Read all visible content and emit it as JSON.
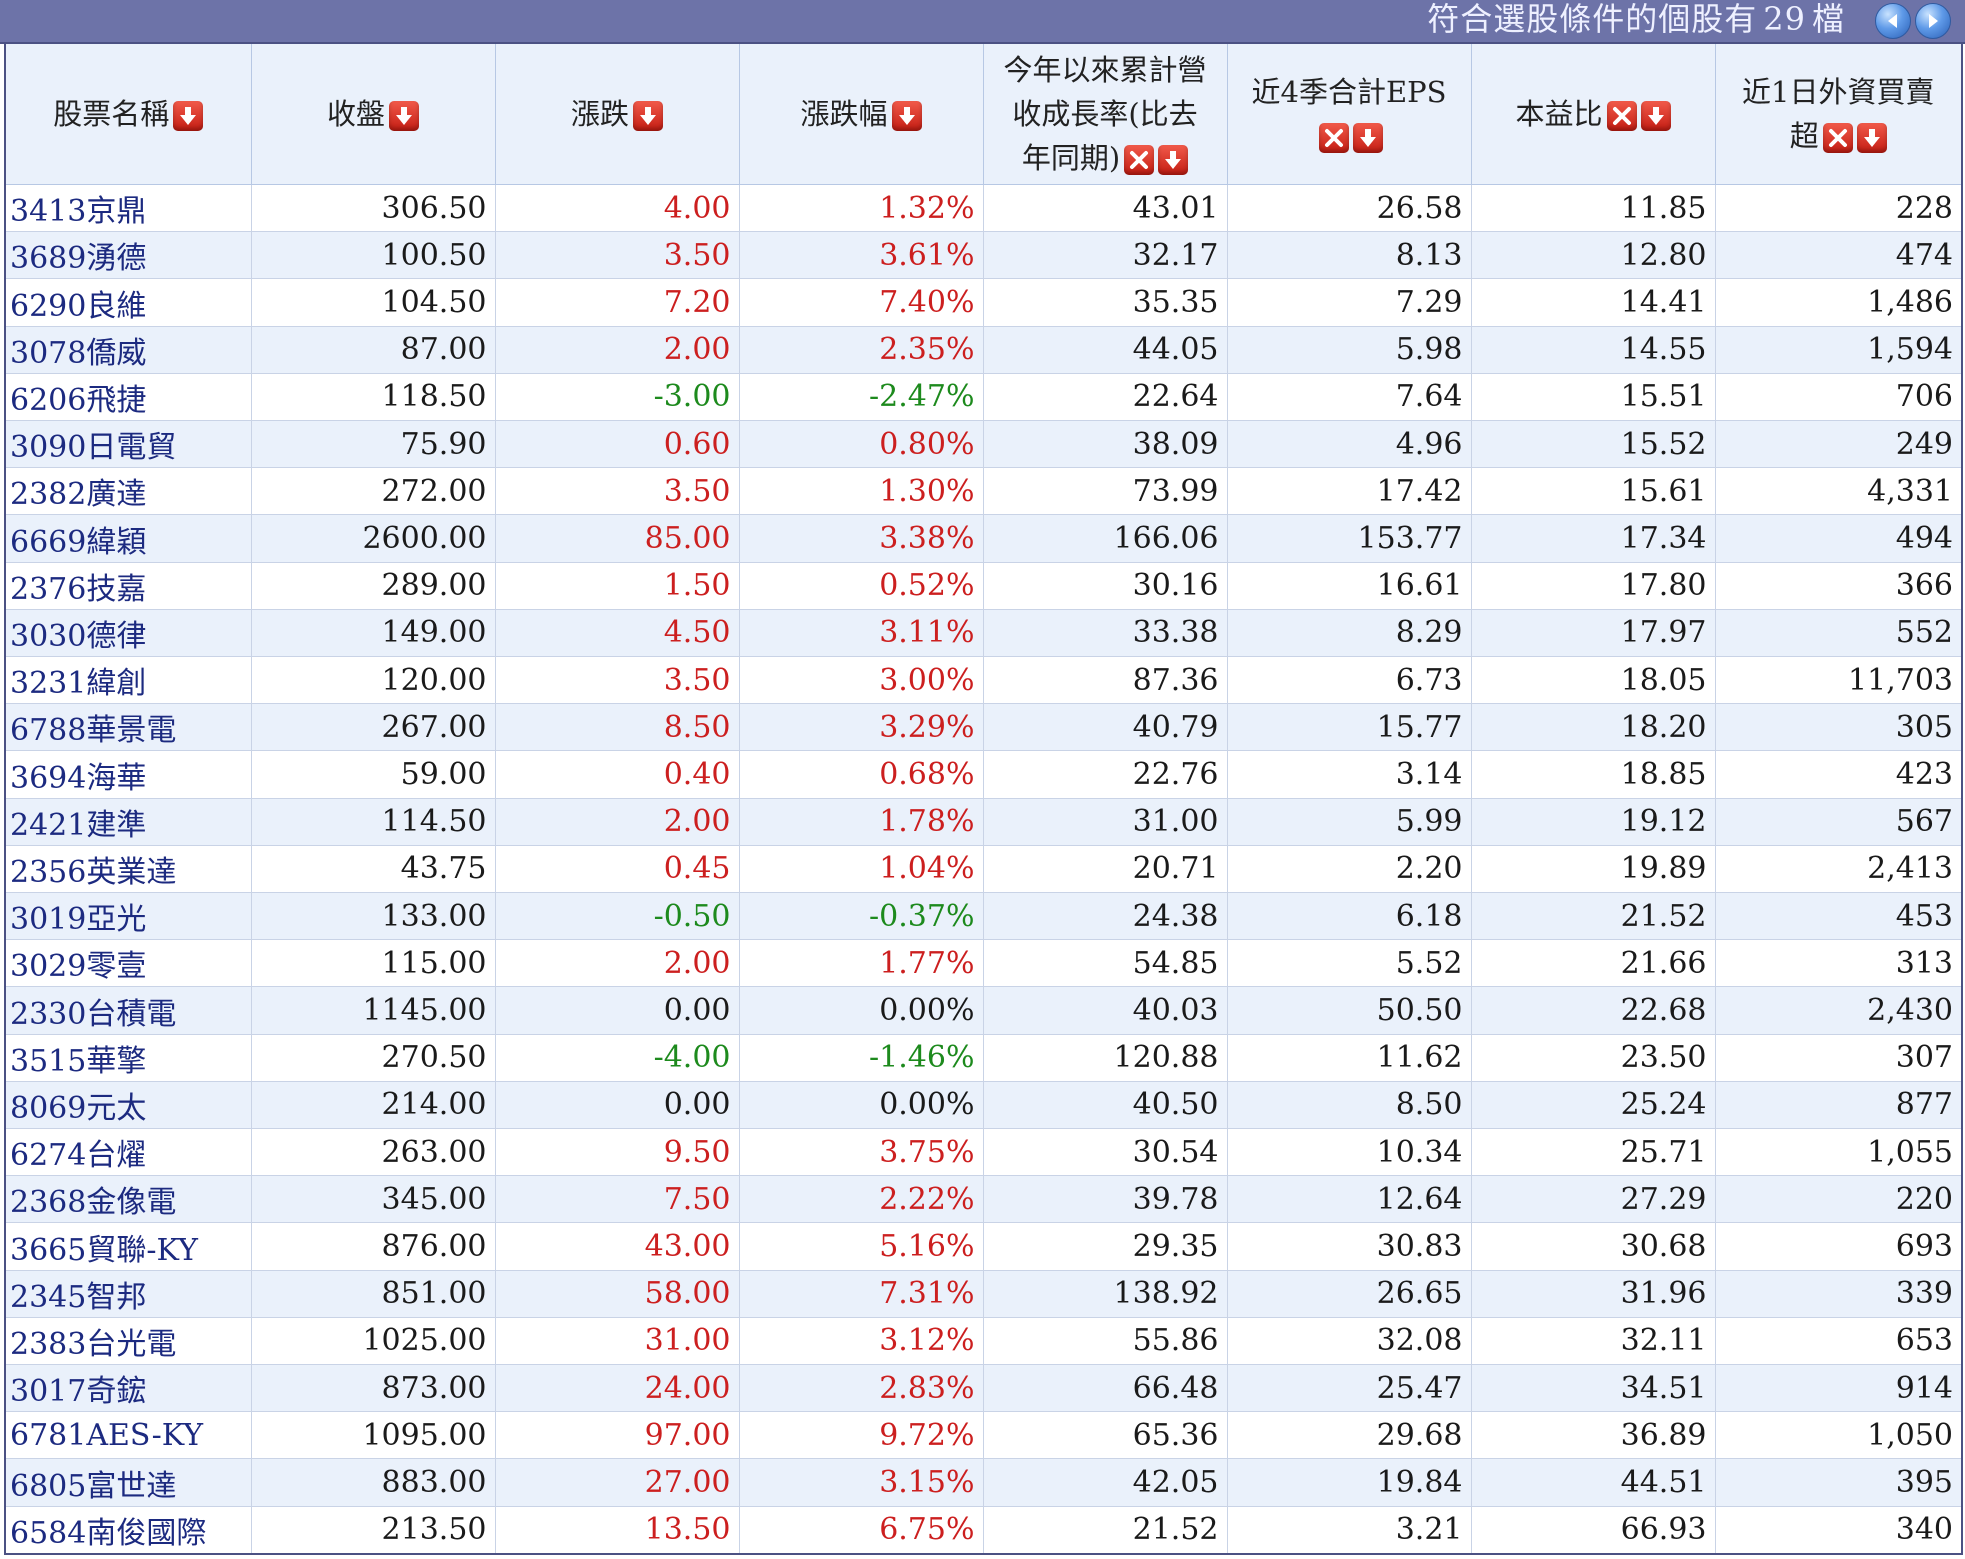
{
  "header": {
    "count_prefix": "符合選股條件的個股有",
    "count_value": "29",
    "count_suffix": "檔"
  },
  "columns": [
    {
      "label": "股票名稱",
      "lines": [
        "股票名稱"
      ],
      "sortable": true,
      "removable": false
    },
    {
      "label": "收盤",
      "lines": [
        "收盤"
      ],
      "sortable": true,
      "removable": false
    },
    {
      "label": "漲跌",
      "lines": [
        "漲跌"
      ],
      "sortable": true,
      "removable": false
    },
    {
      "label": "漲跌幅",
      "lines": [
        "漲跌幅"
      ],
      "sortable": true,
      "removable": false
    },
    {
      "label": "今年以來累計營收成長率(比去年同期)",
      "lines": [
        "今年以來累計營",
        "收成長率(比去",
        "年同期)"
      ],
      "sortable": true,
      "removable": true
    },
    {
      "label": "近4季合計EPS",
      "lines": [
        "近4季合計EPS"
      ],
      "sortable": true,
      "removable": true
    },
    {
      "label": "本益比",
      "lines": [
        "本益比"
      ],
      "sortable": true,
      "removable": true
    },
    {
      "label": "近1日外資買賣超",
      "lines": [
        "近1日外資買賣",
        "超"
      ],
      "sortable": true,
      "removable": true
    }
  ],
  "rows": [
    {
      "name": "3413京鼎",
      "close": "306.50",
      "chg": "4.00",
      "pct": "1.32%",
      "rev": "43.01",
      "eps": "26.58",
      "pe": "11.85",
      "foreign": "228",
      "dir": "up"
    },
    {
      "name": "3689湧德",
      "close": "100.50",
      "chg": "3.50",
      "pct": "3.61%",
      "rev": "32.17",
      "eps": "8.13",
      "pe": "12.80",
      "foreign": "474",
      "dir": "up"
    },
    {
      "name": "6290良維",
      "close": "104.50",
      "chg": "7.20",
      "pct": "7.40%",
      "rev": "35.35",
      "eps": "7.29",
      "pe": "14.41",
      "foreign": "1,486",
      "dir": "up"
    },
    {
      "name": "3078僑威",
      "close": "87.00",
      "chg": "2.00",
      "pct": "2.35%",
      "rev": "44.05",
      "eps": "5.98",
      "pe": "14.55",
      "foreign": "1,594",
      "dir": "up"
    },
    {
      "name": "6206飛捷",
      "close": "118.50",
      "chg": "-3.00",
      "pct": "-2.47%",
      "rev": "22.64",
      "eps": "7.64",
      "pe": "15.51",
      "foreign": "706",
      "dir": "down"
    },
    {
      "name": "3090日電貿",
      "close": "75.90",
      "chg": "0.60",
      "pct": "0.80%",
      "rev": "38.09",
      "eps": "4.96",
      "pe": "15.52",
      "foreign": "249",
      "dir": "up"
    },
    {
      "name": "2382廣達",
      "close": "272.00",
      "chg": "3.50",
      "pct": "1.30%",
      "rev": "73.99",
      "eps": "17.42",
      "pe": "15.61",
      "foreign": "4,331",
      "dir": "up"
    },
    {
      "name": "6669緯穎",
      "close": "2600.00",
      "chg": "85.00",
      "pct": "3.38%",
      "rev": "166.06",
      "eps": "153.77",
      "pe": "17.34",
      "foreign": "494",
      "dir": "up"
    },
    {
      "name": "2376技嘉",
      "close": "289.00",
      "chg": "1.50",
      "pct": "0.52%",
      "rev": "30.16",
      "eps": "16.61",
      "pe": "17.80",
      "foreign": "366",
      "dir": "up"
    },
    {
      "name": "3030德律",
      "close": "149.00",
      "chg": "4.50",
      "pct": "3.11%",
      "rev": "33.38",
      "eps": "8.29",
      "pe": "17.97",
      "foreign": "552",
      "dir": "up"
    },
    {
      "name": "3231緯創",
      "close": "120.00",
      "chg": "3.50",
      "pct": "3.00%",
      "rev": "87.36",
      "eps": "6.73",
      "pe": "18.05",
      "foreign": "11,703",
      "dir": "up"
    },
    {
      "name": "6788華景電",
      "close": "267.00",
      "chg": "8.50",
      "pct": "3.29%",
      "rev": "40.79",
      "eps": "15.77",
      "pe": "18.20",
      "foreign": "305",
      "dir": "up"
    },
    {
      "name": "3694海華",
      "close": "59.00",
      "chg": "0.40",
      "pct": "0.68%",
      "rev": "22.76",
      "eps": "3.14",
      "pe": "18.85",
      "foreign": "423",
      "dir": "up"
    },
    {
      "name": "2421建準",
      "close": "114.50",
      "chg": "2.00",
      "pct": "1.78%",
      "rev": "31.00",
      "eps": "5.99",
      "pe": "19.12",
      "foreign": "567",
      "dir": "up"
    },
    {
      "name": "2356英業達",
      "close": "43.75",
      "chg": "0.45",
      "pct": "1.04%",
      "rev": "20.71",
      "eps": "2.20",
      "pe": "19.89",
      "foreign": "2,413",
      "dir": "up"
    },
    {
      "name": "3019亞光",
      "close": "133.00",
      "chg": "-0.50",
      "pct": "-0.37%",
      "rev": "24.38",
      "eps": "6.18",
      "pe": "21.52",
      "foreign": "453",
      "dir": "down"
    },
    {
      "name": "3029零壹",
      "close": "115.00",
      "chg": "2.00",
      "pct": "1.77%",
      "rev": "54.85",
      "eps": "5.52",
      "pe": "21.66",
      "foreign": "313",
      "dir": "up"
    },
    {
      "name": "2330台積電",
      "close": "1145.00",
      "chg": "0.00",
      "pct": "0.00%",
      "rev": "40.03",
      "eps": "50.50",
      "pe": "22.68",
      "foreign": "2,430",
      "dir": "flat"
    },
    {
      "name": "3515華擎",
      "close": "270.50",
      "chg": "-4.00",
      "pct": "-1.46%",
      "rev": "120.88",
      "eps": "11.62",
      "pe": "23.50",
      "foreign": "307",
      "dir": "down"
    },
    {
      "name": "8069元太",
      "close": "214.00",
      "chg": "0.00",
      "pct": "0.00%",
      "rev": "40.50",
      "eps": "8.50",
      "pe": "25.24",
      "foreign": "877",
      "dir": "flat"
    },
    {
      "name": "6274台燿",
      "close": "263.00",
      "chg": "9.50",
      "pct": "3.75%",
      "rev": "30.54",
      "eps": "10.34",
      "pe": "25.71",
      "foreign": "1,055",
      "dir": "up"
    },
    {
      "name": "2368金像電",
      "close": "345.00",
      "chg": "7.50",
      "pct": "2.22%",
      "rev": "39.78",
      "eps": "12.64",
      "pe": "27.29",
      "foreign": "220",
      "dir": "up"
    },
    {
      "name": "3665貿聯-KY",
      "close": "876.00",
      "chg": "43.00",
      "pct": "5.16%",
      "rev": "29.35",
      "eps": "30.83",
      "pe": "30.68",
      "foreign": "693",
      "dir": "up"
    },
    {
      "name": "2345智邦",
      "close": "851.00",
      "chg": "58.00",
      "pct": "7.31%",
      "rev": "138.92",
      "eps": "26.65",
      "pe": "31.96",
      "foreign": "339",
      "dir": "up"
    },
    {
      "name": "2383台光電",
      "close": "1025.00",
      "chg": "31.00",
      "pct": "3.12%",
      "rev": "55.86",
      "eps": "32.08",
      "pe": "32.11",
      "foreign": "653",
      "dir": "up"
    },
    {
      "name": "3017奇鋐",
      "close": "873.00",
      "chg": "24.00",
      "pct": "2.83%",
      "rev": "66.48",
      "eps": "25.47",
      "pe": "34.51",
      "foreign": "914",
      "dir": "up"
    },
    {
      "name": "6781AES-KY",
      "close": "1095.00",
      "chg": "97.00",
      "pct": "9.72%",
      "rev": "65.36",
      "eps": "29.68",
      "pe": "36.89",
      "foreign": "1,050",
      "dir": "up"
    },
    {
      "name": "6805富世達",
      "close": "883.00",
      "chg": "27.00",
      "pct": "3.15%",
      "rev": "42.05",
      "eps": "19.84",
      "pe": "44.51",
      "foreign": "395",
      "dir": "up"
    },
    {
      "name": "6584南俊國際",
      "close": "213.50",
      "chg": "13.50",
      "pct": "6.75%",
      "rev": "21.52",
      "eps": "3.21",
      "pe": "66.93",
      "foreign": "340",
      "dir": "up"
    }
  ],
  "colors": {
    "up": "#cc1f1f",
    "down": "#1d8a1d",
    "header_bar": "#6d73a8",
    "row_alt": "#eaf1fb",
    "name_text": "#1c2a80"
  },
  "icons": {
    "sort": "sort-desc-icon",
    "remove": "remove-column-icon",
    "prev": "prev-page-icon",
    "next": "next-page-icon"
  }
}
